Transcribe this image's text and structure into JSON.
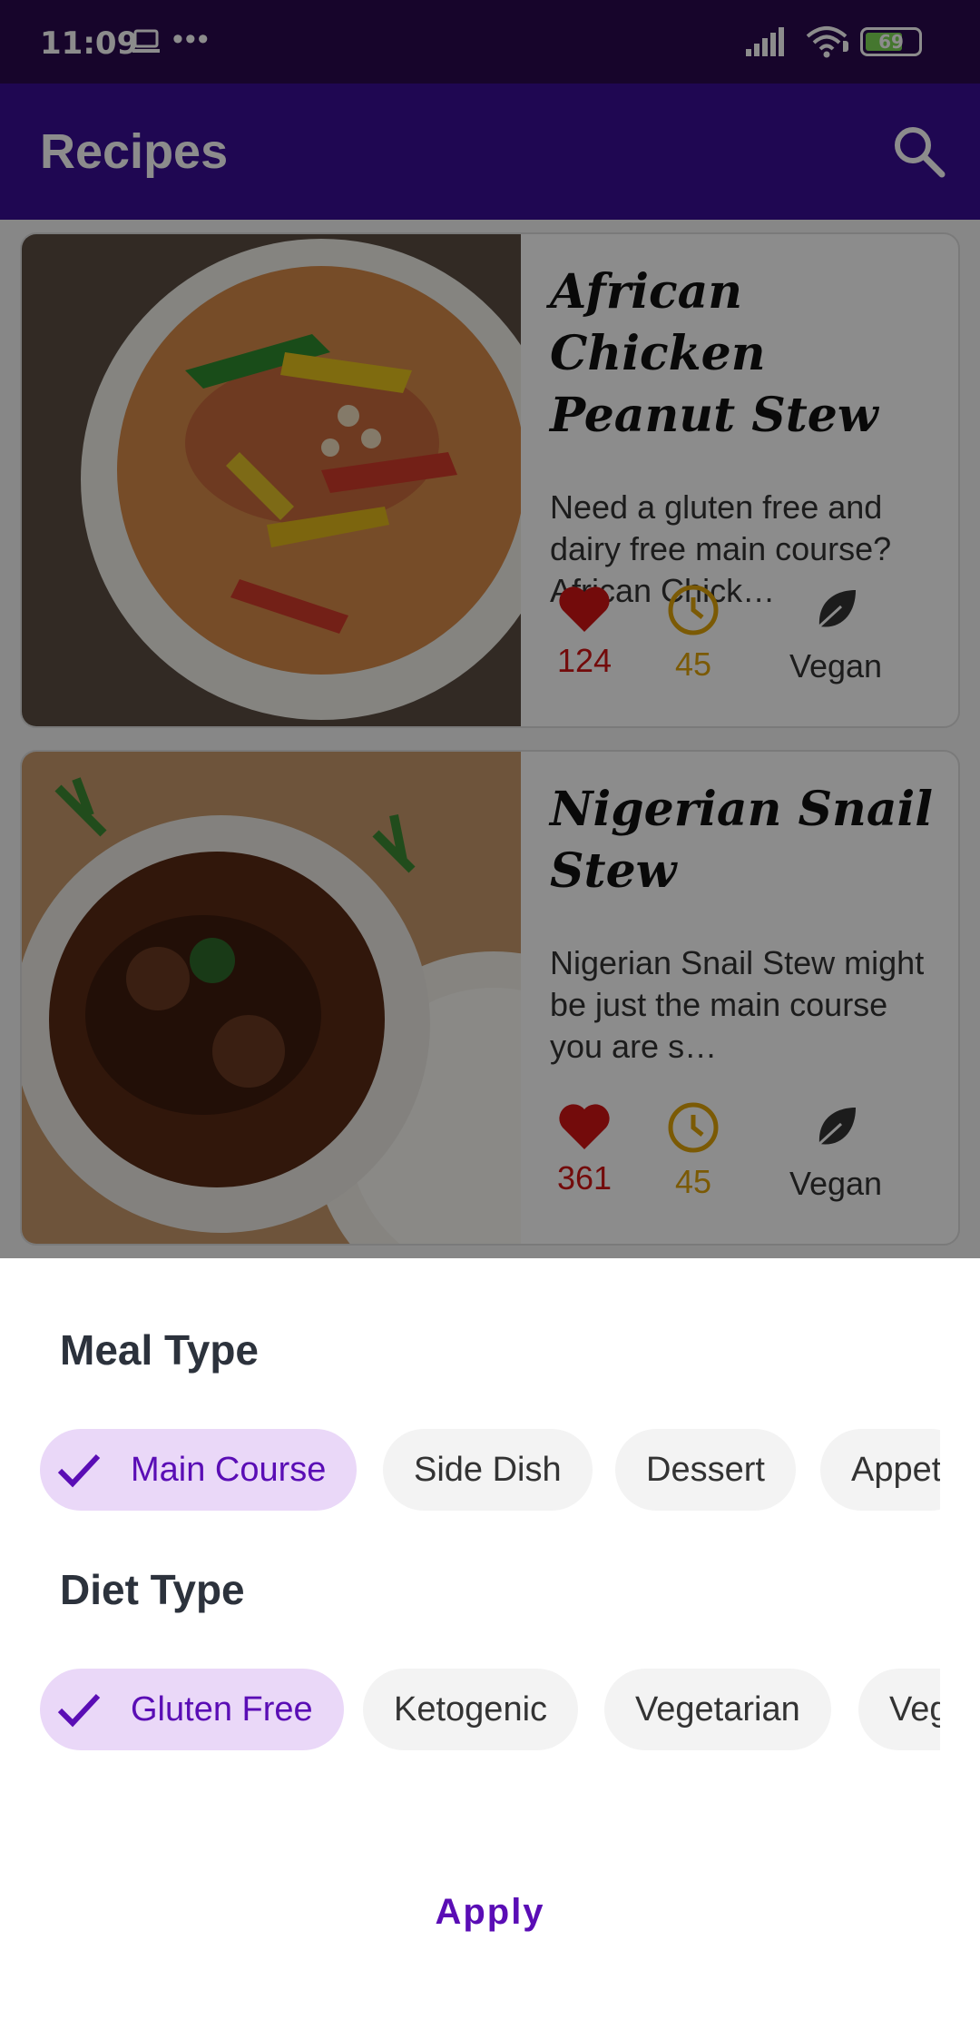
{
  "status_bar": {
    "time": "11:09",
    "battery": "69"
  },
  "app_bar": {
    "title": "Recipes"
  },
  "recipes": [
    {
      "title": "African Chicken Peanut Stew",
      "description": "Need a gluten free and dairy free main course? African Chick…",
      "likes": "124",
      "minutes": "45",
      "vegan_label": "Vegan"
    },
    {
      "title": "Nigerian Snail Stew",
      "description": "Nigerian Snail Stew might be just the main course you are s…",
      "likes": "361",
      "minutes": "45",
      "vegan_label": "Vegan"
    }
  ],
  "filter_sheet": {
    "meal_type_title": "Meal Type",
    "meal_types": [
      "Main Course",
      "Side Dish",
      "Dessert",
      "Appet"
    ],
    "meal_type_selected": "Main Course",
    "diet_type_title": "Diet Type",
    "diet_types": [
      "Gluten Free",
      "Ketogenic",
      "Vegetarian",
      "Veg"
    ],
    "diet_type_selected": "Gluten Free",
    "apply_label": "Apply"
  },
  "colors": {
    "primary": "#3a0d96",
    "status_bar": "#2a0a4f",
    "chip_selected_bg": "#ead8f8",
    "chip_selected_text": "#5a0db5",
    "heart": "#d21515",
    "clock": "#e1a40a"
  }
}
